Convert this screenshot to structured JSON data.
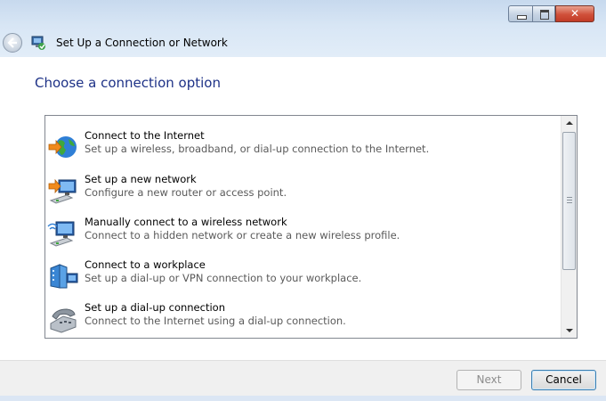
{
  "window": {
    "title": "Set Up a Connection or Network"
  },
  "heading": "Choose a connection option",
  "options": [
    {
      "title": "Connect to the Internet",
      "description": "Set up a wireless, broadband, or dial-up connection to the Internet.",
      "icon": "globe-internet-icon"
    },
    {
      "title": "Set up a new network",
      "description": "Configure a new router or access point.",
      "icon": "new-network-icon"
    },
    {
      "title": "Manually connect to a wireless network",
      "description": "Connect to a hidden network or create a new wireless profile.",
      "icon": "wireless-network-icon"
    },
    {
      "title": "Connect to a workplace",
      "description": "Set up a dial-up or VPN connection to your workplace.",
      "icon": "workplace-icon"
    },
    {
      "title": "Set up a dial-up connection",
      "description": "Connect to the Internet using a dial-up connection.",
      "icon": "dialup-phone-icon"
    }
  ],
  "buttons": {
    "next": "Next",
    "cancel": "Cancel"
  },
  "colors": {
    "heading": "#1e3287",
    "titlebar": "#d8e6f5",
    "close_button": "#c23b26"
  }
}
